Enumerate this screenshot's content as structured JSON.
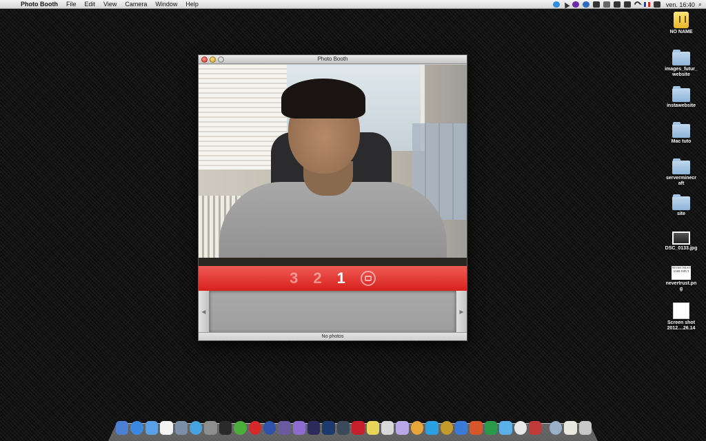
{
  "menubar": {
    "apple": "",
    "app_name": "Photo Booth",
    "items": [
      "File",
      "Edit",
      "View",
      "Camera",
      "Window",
      "Help"
    ],
    "clock": "ven. 16:40"
  },
  "window": {
    "title": "Photo Booth",
    "countdown": [
      "3",
      "2",
      "1"
    ],
    "active_count": "1",
    "status": "No photos"
  },
  "desktop_icons": [
    {
      "label": "NO NAME",
      "icon": "usb-drive-icon"
    },
    {
      "label": "images_futur_\nwebsite",
      "icon": "folder-icon"
    },
    {
      "label": "instawebsite",
      "icon": "folder-icon"
    },
    {
      "label": "Mac tuto",
      "icon": "folder-icon"
    },
    {
      "label": "serverminecr\naft",
      "icon": "folder-icon"
    },
    {
      "label": "site",
      "icon": "folder-icon"
    },
    {
      "label": "DSC_0133.jpg",
      "icon": "image-file-icon"
    },
    {
      "label": "nevertrust.pn\ng",
      "icon": "image-file-icon"
    },
    {
      "label": "Screen shot\n2012....26.14",
      "icon": "screenshot-file-icon"
    }
  ],
  "nevertrust_thumb_text": "NEVER TRUST USER INPUT",
  "colors": {
    "accent_red": "#d8211c",
    "countdown_inactive": "rgba(255,255,255,0.45)",
    "countdown_active": "#ffffff"
  }
}
